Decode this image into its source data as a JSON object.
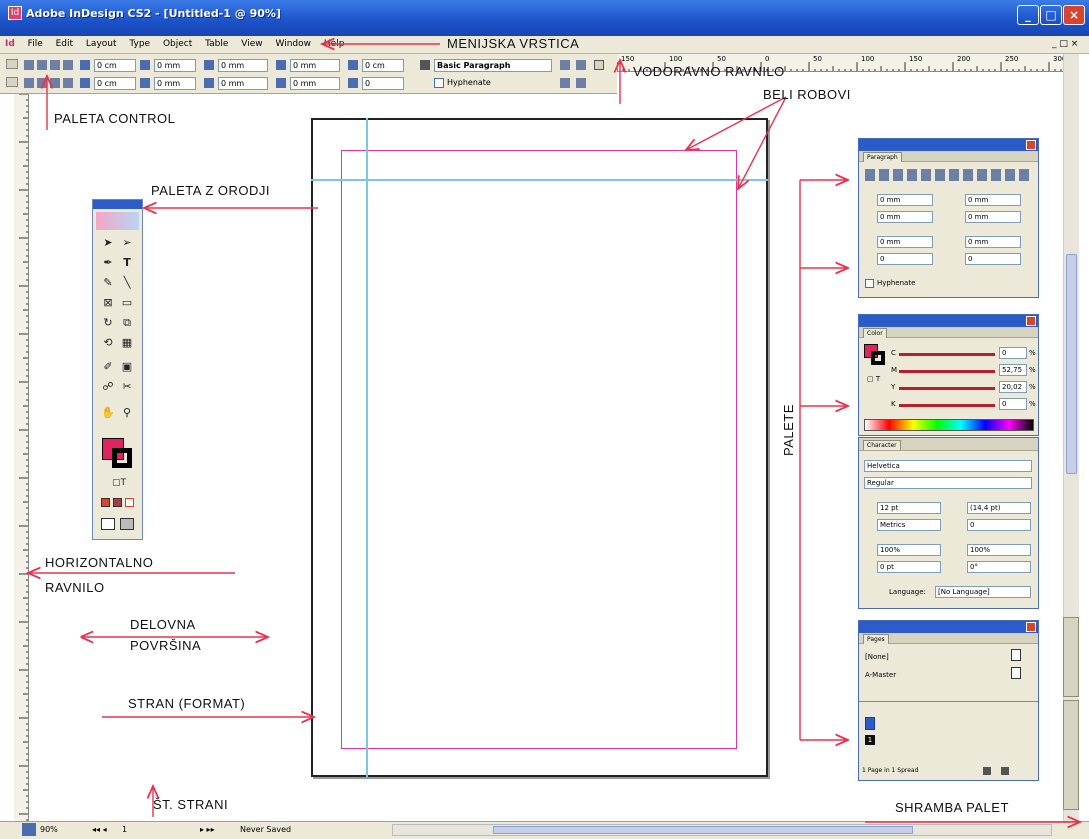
{
  "window": {
    "title": "Adobe InDesign CS2 - [Untitled-1 @ 90%]"
  },
  "menu": [
    "File",
    "Edit",
    "Layout",
    "Type",
    "Object",
    "Table",
    "View",
    "Window",
    "Help"
  ],
  "control": {
    "f1": "0 cm",
    "f2": "0 cm",
    "f3": "0 cm",
    "f4": "0 mm",
    "f5": "0 mm",
    "f6": "0 mm",
    "f7": "0 mm",
    "f8": "0 mm",
    "f9": "0 mm",
    "f10": "0",
    "para_style": "Basic Paragraph",
    "hyphenate": "Hyphenate"
  },
  "ruler_ticks": [
    "150",
    "100",
    "50",
    "0",
    "50",
    "100",
    "150",
    "200",
    "250",
    "300"
  ],
  "paragraph": {
    "tab": "Paragraph",
    "f1": "0 mm",
    "f2": "0 mm",
    "f3": "0 mm",
    "f4": "0 mm",
    "f5": "0 mm",
    "f6": "0 mm",
    "f7": "0",
    "f8": "0",
    "hyphenate": "Hyphenate"
  },
  "color": {
    "tab": "Color",
    "c": "0",
    "m": "52,75",
    "y": "20,02",
    "k": "0",
    "pct": "%",
    "labels": [
      "C",
      "M",
      "Y",
      "K"
    ],
    "fill": "#e0245e"
  },
  "character": {
    "tab": "Character",
    "font": "Helvetica",
    "style": "Regular",
    "size": "12 pt",
    "leading": "(14,4 pt)",
    "kerning": "Metrics",
    "tracking": "0",
    "vscale": "100%",
    "hscale": "100%",
    "baseline": "0 pt",
    "skew": "0°",
    "language_label": "Language:",
    "language": "[No Language]"
  },
  "pages": {
    "tab": "Pages",
    "none": "[None]",
    "master": "A-Master",
    "footer": "1 Page in 1 Spread"
  },
  "status": {
    "zoom": "90%",
    "page": "1",
    "state": "Never Saved"
  },
  "annotations": {
    "menu": "MENIJSKA VRSTICA",
    "hruler": "VODORAVNO RAVNILO",
    "bleed": "BELI ROBOVI",
    "control": "PALETA CONTROL",
    "tools": "PALETA Z ORODJI",
    "palettes": "PALETE",
    "vruler_1": "HORIZONTALNO",
    "vruler_2": "RAVNILO",
    "workspace_1": "DELOVNA",
    "workspace_2": "POVRŠINA",
    "page": "STRAN (FORMAT)",
    "pagenum": "ŠT. STRANI",
    "dock": "SHRAMBA PALET"
  },
  "colors": {
    "annotation_arrow": "#e8334f",
    "title_blue": "#1b52c9",
    "margin": "#e0379b",
    "guide": "#7cc8e0"
  }
}
